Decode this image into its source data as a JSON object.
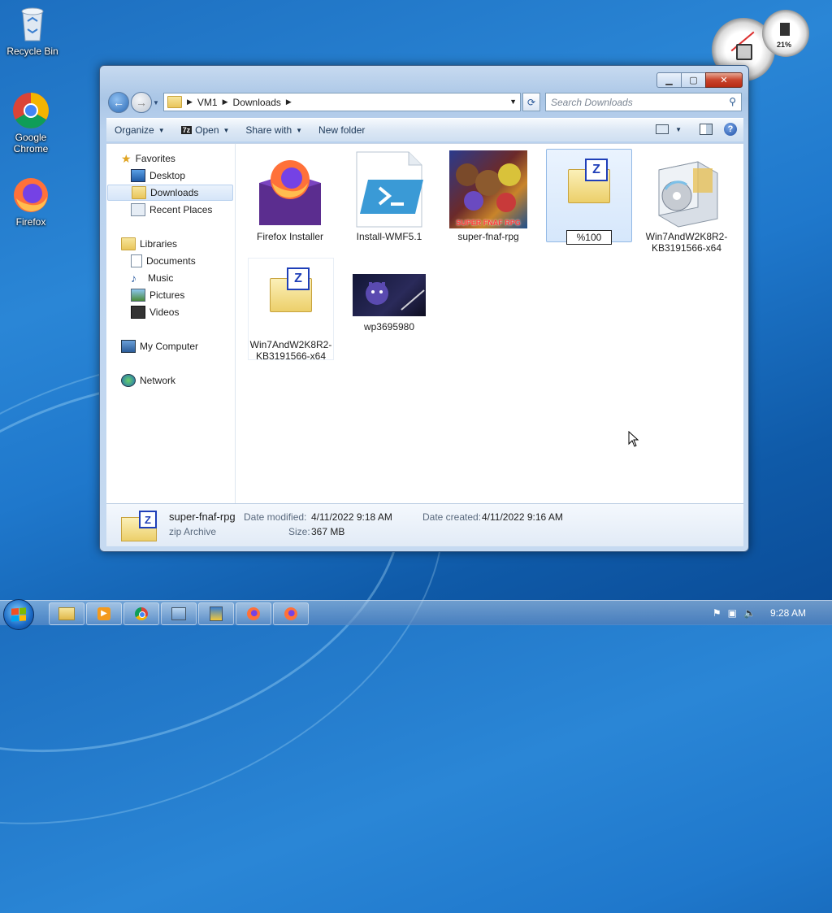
{
  "desktop": {
    "icons": [
      {
        "label": "Recycle Bin",
        "icon": "recycle-bin-icon"
      },
      {
        "label": "Google Chrome",
        "icon": "chrome-icon"
      },
      {
        "label": "Firefox",
        "icon": "firefox-icon"
      }
    ],
    "gadget": {
      "cpu_meter_text": "21%"
    }
  },
  "explorer": {
    "breadcrumb": [
      "VM1",
      "Downloads"
    ],
    "search_placeholder": "Search Downloads",
    "toolbar": {
      "organize": "Organize",
      "open": "Open",
      "share_with": "Share with",
      "new_folder": "New folder"
    },
    "nav": {
      "favorites": "Favorites",
      "desktop": "Desktop",
      "downloads": "Downloads",
      "recent_places": "Recent Places",
      "libraries": "Libraries",
      "documents": "Documents",
      "music": "Music",
      "pictures": "Pictures",
      "videos": "Videos",
      "my_computer": "My Computer",
      "network": "Network"
    },
    "files": [
      {
        "name": "Firefox Installer"
      },
      {
        "name": "Install-WMF5.1"
      },
      {
        "name": "super-fnaf-rpg",
        "thumb_text": "SUPER FNAF RPG"
      },
      {
        "name": "%100"
      },
      {
        "name": "Win7AndW2K8R2-KB3191566-x64"
      },
      {
        "name": "Win7AndW2K8R2-KB3191566-x64"
      },
      {
        "name": "wp3695980"
      }
    ],
    "details": {
      "name": "super-fnaf-rpg",
      "type": "zip Archive",
      "date_modified_label": "Date modified:",
      "date_modified": "4/11/2022 9:18 AM",
      "date_created_label": "Date created:",
      "date_created": "4/11/2022 9:16 AM",
      "size_label": "Size:",
      "size": "367 MB"
    }
  },
  "taskbar": {
    "clock": "9:28 AM"
  }
}
